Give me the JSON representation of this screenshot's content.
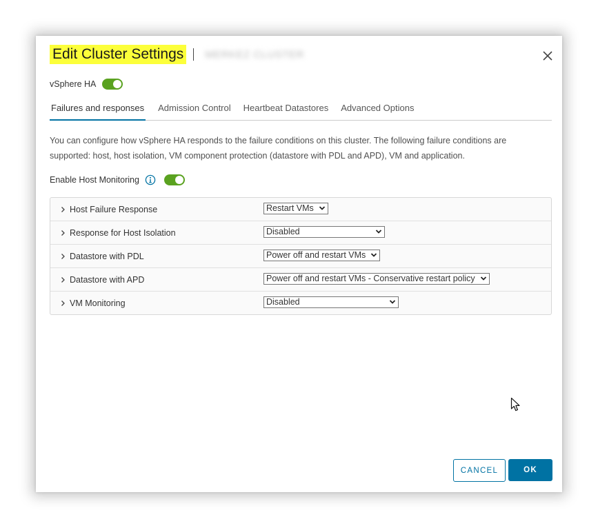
{
  "dialog": {
    "title": "Edit Cluster Settings",
    "cluster_name": "MERKEZ CLUSTER",
    "close_icon": "close-icon"
  },
  "vsphere_ha": {
    "label": "vSphere HA",
    "enabled": true
  },
  "tabs": [
    {
      "label": "Failures and responses",
      "active": true
    },
    {
      "label": "Admission Control",
      "active": false
    },
    {
      "label": "Heartbeat Datastores",
      "active": false
    },
    {
      "label": "Advanced Options",
      "active": false
    }
  ],
  "description": "You can configure how vSphere HA responds to the failure conditions on this cluster. The following failure conditions are supported: host, host isolation, VM component protection (datastore with PDL and APD), VM and application.",
  "host_monitoring": {
    "label": "Enable Host Monitoring",
    "enabled": true,
    "info_icon": "info-icon"
  },
  "settings": [
    {
      "label": "Host Failure Response",
      "value": "Restart VMs"
    },
    {
      "label": "Response for Host Isolation",
      "value": "Disabled"
    },
    {
      "label": "Datastore with PDL",
      "value": "Power off and restart VMs"
    },
    {
      "label": "Datastore with APD",
      "value": "Power off and restart VMs - Conservative restart policy"
    },
    {
      "label": "VM Monitoring",
      "value": "Disabled"
    }
  ],
  "buttons": {
    "cancel": "CANCEL",
    "ok": "OK"
  },
  "colors": {
    "accent": "#0072a3",
    "toggle_on": "#5aa220",
    "highlight": "#fcff3a"
  }
}
